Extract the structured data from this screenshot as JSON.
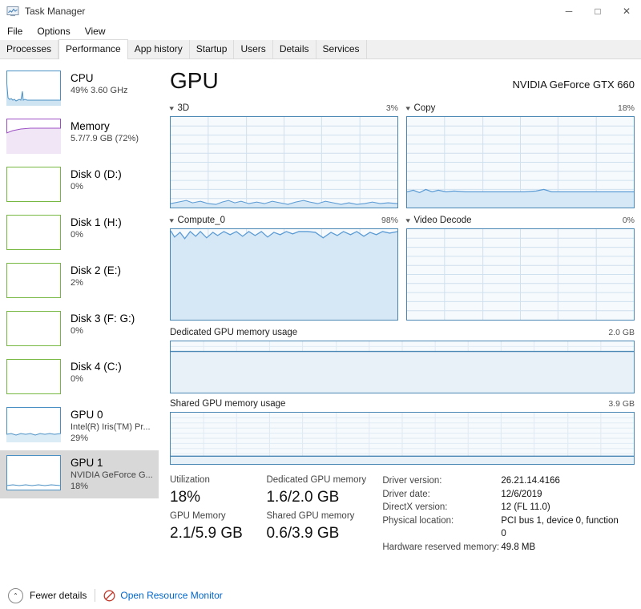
{
  "window": {
    "title": "Task Manager",
    "icon": "task-manager-icon",
    "minimize": "─",
    "maximize": "□",
    "close": "✕"
  },
  "menu": [
    "File",
    "Options",
    "View"
  ],
  "tabs": [
    {
      "label": "Processes",
      "active": false
    },
    {
      "label": "Performance",
      "active": true
    },
    {
      "label": "App history",
      "active": false
    },
    {
      "label": "Startup",
      "active": false
    },
    {
      "label": "Users",
      "active": false
    },
    {
      "label": "Details",
      "active": false
    },
    {
      "label": "Services",
      "active": false
    }
  ],
  "sidebar": {
    "items": [
      {
        "name": "CPU",
        "sub": "49%  3.60 GHz",
        "sub2": "",
        "color": "#4a90c4",
        "fill": "#cfe4f2",
        "selected": false,
        "graph": "spiky",
        "level": 49
      },
      {
        "name": "Memory",
        "sub": "5.7/7.9 GB (72%)",
        "sub2": "",
        "color": "#9c4fc4",
        "fill": "#f0e6f5",
        "selected": false,
        "graph": "flat-high",
        "level": 72
      },
      {
        "name": "Disk 0 (D:)",
        "sub": "0%",
        "sub2": "",
        "color": "#77b843",
        "fill": "#ffffff",
        "selected": false,
        "graph": "empty",
        "level": 0
      },
      {
        "name": "Disk 1 (H:)",
        "sub": "0%",
        "sub2": "",
        "color": "#77b843",
        "fill": "#ffffff",
        "selected": false,
        "graph": "empty",
        "level": 0
      },
      {
        "name": "Disk 2 (E:)",
        "sub": "2%",
        "sub2": "",
        "color": "#77b843",
        "fill": "#ffffff",
        "selected": false,
        "graph": "empty",
        "level": 2
      },
      {
        "name": "Disk 3 (F: G:)",
        "sub": "0%",
        "sub2": "",
        "color": "#77b843",
        "fill": "#ffffff",
        "selected": false,
        "graph": "empty",
        "level": 0
      },
      {
        "name": "Disk 4 (C:)",
        "sub": "0%",
        "sub2": "",
        "color": "#77b843",
        "fill": "#ffffff",
        "selected": false,
        "graph": "empty",
        "level": 0
      },
      {
        "name": "GPU 0",
        "sub": "Intel(R) Iris(TM) Pr...",
        "sub2": "29%",
        "color": "#4a90c4",
        "fill": "#dcecf7",
        "selected": false,
        "graph": "low-wave",
        "level": 29
      },
      {
        "name": "GPU 1",
        "sub": "NVIDIA GeForce G...",
        "sub2": "18%",
        "color": "#4a90c4",
        "fill": "#ffffff",
        "selected": true,
        "graph": "low-line",
        "level": 18
      }
    ]
  },
  "main": {
    "title": "GPU",
    "device": "NVIDIA GeForce GTX 660",
    "engines": [
      {
        "label": "3D",
        "value": "3%",
        "pct": 3,
        "shape": "wave-low"
      },
      {
        "label": "Copy",
        "value": "18%",
        "pct": 18,
        "shape": "fill-low"
      },
      {
        "label": "Compute_0",
        "value": "98%",
        "pct": 98,
        "shape": "wave-high"
      },
      {
        "label": "Video Decode",
        "value": "0%",
        "pct": 0,
        "shape": "empty"
      }
    ],
    "memory_graphs": [
      {
        "label": "Dedicated GPU memory usage",
        "max": "2.0 GB",
        "pct": 80
      },
      {
        "label": "Shared GPU memory usage",
        "max": "3.9 GB",
        "pct": 15
      }
    ],
    "stats": [
      {
        "label": "Utilization",
        "value": "18%"
      },
      {
        "label": "GPU Memory",
        "value": "2.1/5.9 GB"
      }
    ],
    "stats2": [
      {
        "label": "Dedicated GPU memory",
        "value": "1.6/2.0 GB"
      },
      {
        "label": "Shared GPU memory",
        "value": "0.6/3.9 GB"
      }
    ],
    "details": [
      {
        "key": "Driver version:",
        "value": "26.21.14.4166"
      },
      {
        "key": "Driver date:",
        "value": "12/6/2019"
      },
      {
        "key": "DirectX version:",
        "value": "12 (FL 11.0)"
      },
      {
        "key": "Physical location:",
        "value": "PCI bus 1, device 0, function 0"
      },
      {
        "key": "Hardware reserved memory:",
        "value": "49.8 MB"
      }
    ]
  },
  "statusbar": {
    "fewer_details": "Fewer details",
    "chevron": "⌃",
    "resource_monitor": "Open Resource Monitor",
    "resource_icon": "resource-monitor-icon"
  },
  "colors": {
    "accent": "#4a87b5",
    "link": "#0066cc",
    "graph_line": "#5b9bd5",
    "graph_fill": "#d6e8f5"
  }
}
